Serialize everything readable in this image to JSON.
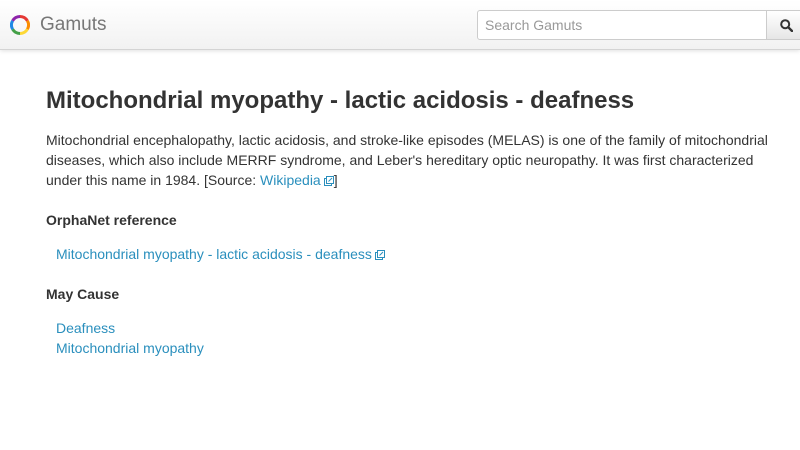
{
  "header": {
    "brand": "Gamuts",
    "search": {
      "placeholder": "Search Gamuts",
      "value": ""
    }
  },
  "main": {
    "title": "Mitochondrial myopathy - lactic acidosis - deafness",
    "description": {
      "text": "Mitochondrial encephalopathy, lactic acidosis, and stroke-like episodes (MELAS) is one of the family of mitochondrial diseases, which also include MERRF syndrome, and Leber's hereditary optic neuropathy. It was first characterized under this name in 1984. [Source: ",
      "source_link": "Wikipedia",
      "suffix": "]"
    },
    "orphanet": {
      "heading": "OrphaNet reference",
      "link": "Mitochondrial myopathy - lactic acidosis - deafness"
    },
    "may_cause": {
      "heading": "May Cause",
      "items": [
        "Deafness",
        "Mitochondrial myopathy"
      ]
    }
  },
  "colors": {
    "link": "#2a8fbd",
    "text": "#333333",
    "brand_text": "#777777",
    "navbar_border": "#d4d4d4"
  },
  "icons": [
    "gamuts-ring-logo-icon",
    "search-icon",
    "external-link-icon"
  ]
}
